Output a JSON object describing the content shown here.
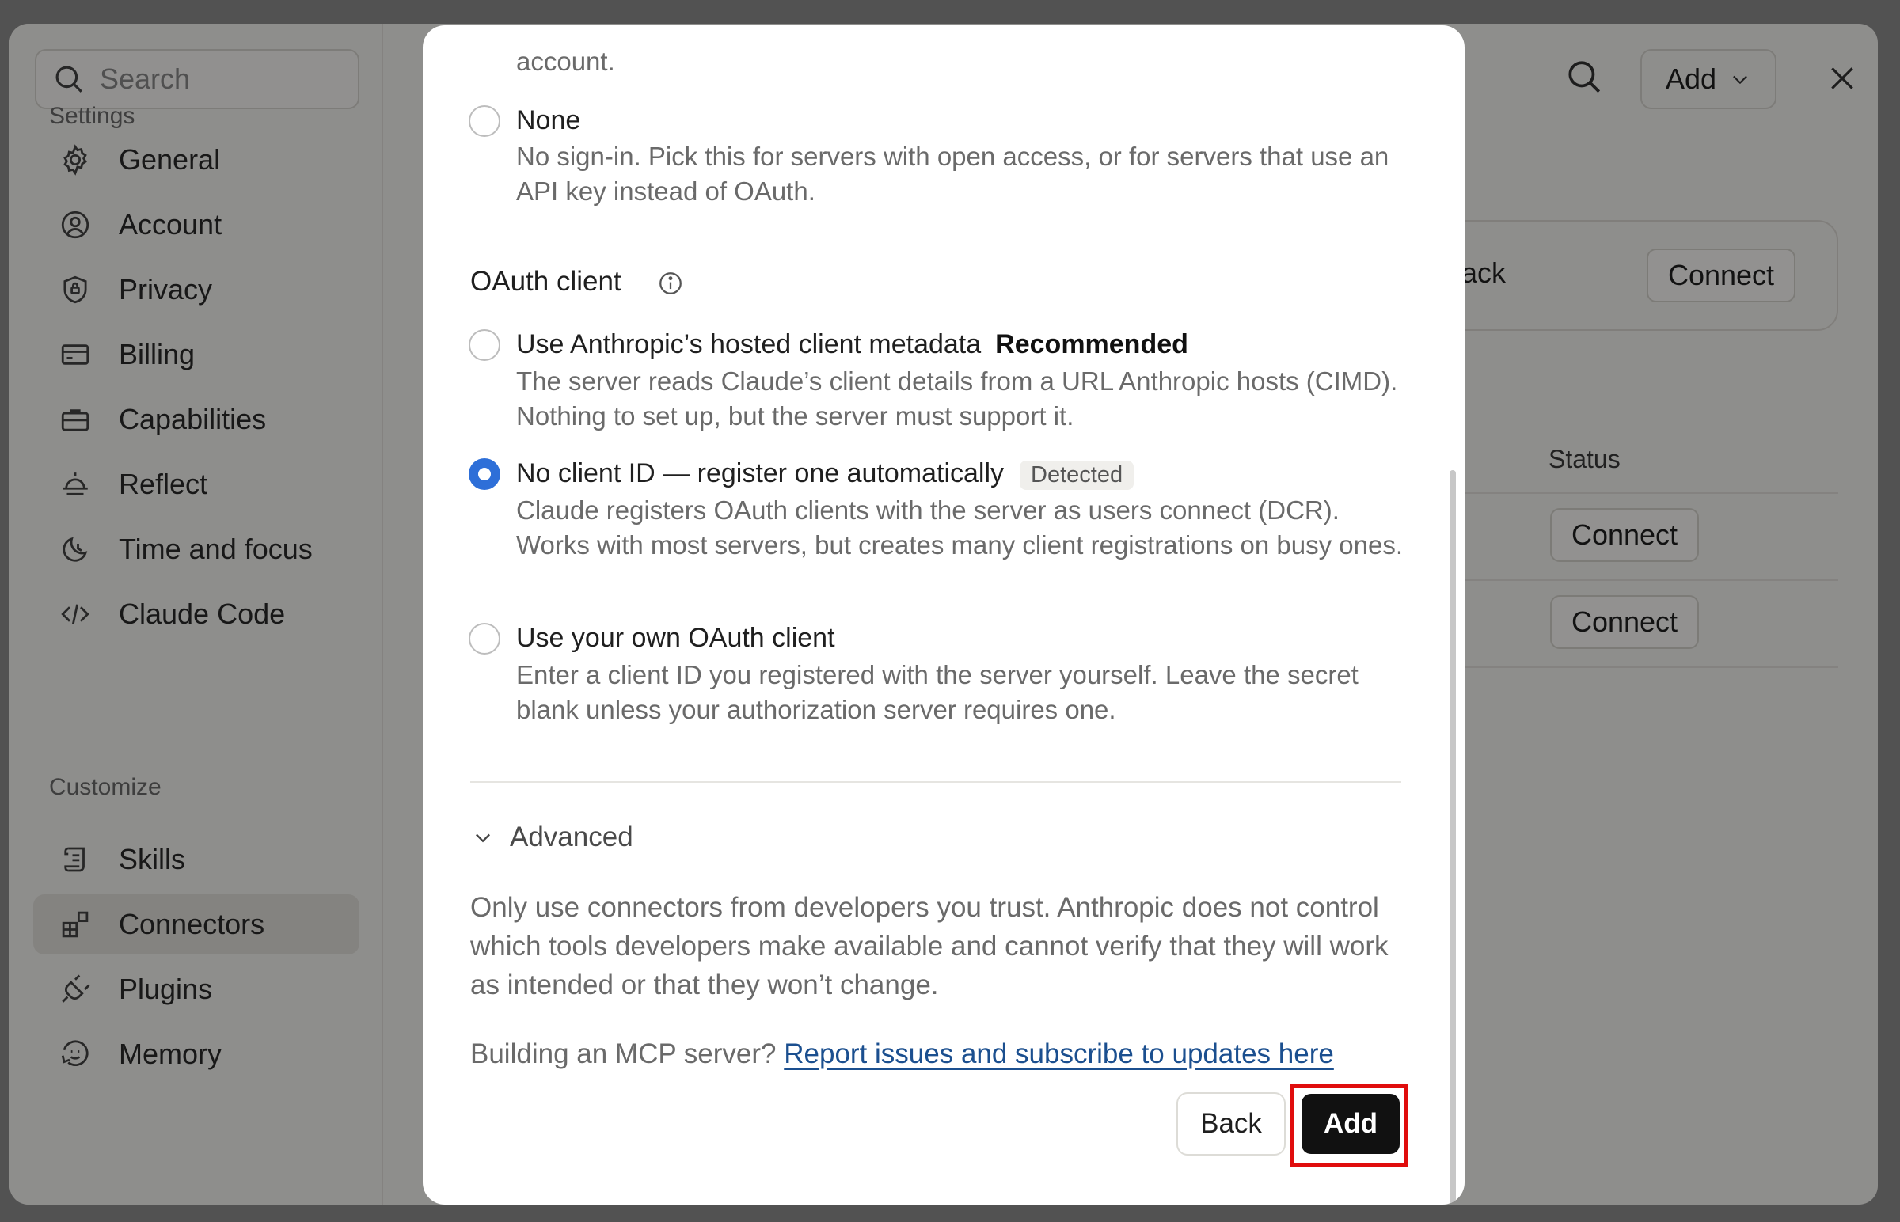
{
  "sidebar": {
    "search_placeholder": "Search",
    "settings_label": "Settings",
    "customize_label": "Customize",
    "settings_items": [
      {
        "label": "General",
        "icon": "gear-icon"
      },
      {
        "label": "Account",
        "icon": "user-circle-icon"
      },
      {
        "label": "Privacy",
        "icon": "shield-icon"
      },
      {
        "label": "Billing",
        "icon": "credit-card-icon"
      },
      {
        "label": "Capabilities",
        "icon": "briefcase-icon"
      },
      {
        "label": "Reflect",
        "icon": "sunrise-icon"
      },
      {
        "label": "Time and focus",
        "icon": "moon-clock-icon"
      },
      {
        "label": "Claude Code",
        "icon": "code-icon"
      }
    ],
    "customize_items": [
      {
        "label": "Skills",
        "icon": "scroll-icon"
      },
      {
        "label": "Connectors",
        "icon": "grid-plus-icon",
        "active": true
      },
      {
        "label": "Plugins",
        "icon": "plug-icon"
      },
      {
        "label": "Memory",
        "icon": "memory-icon"
      }
    ]
  },
  "main": {
    "add_label": "Add",
    "slack_name": "Slack",
    "connect_label": "Connect",
    "status_header": "Status"
  },
  "modal": {
    "clipped_top_text": "account.",
    "none_option": {
      "title": "None",
      "desc": "No sign-in. Pick this for servers with open access, or for servers that use an API key instead of OAuth."
    },
    "oauth_section_title": "OAuth client",
    "options": [
      {
        "title": "Use Anthropic’s hosted client metadata",
        "badge": "Recommended",
        "desc": "The server reads Claude’s client details from a URL Anthropic hosts (CIMD). Nothing to set up, but the server must support it.",
        "checked": false
      },
      {
        "title": "No client ID — register one automatically",
        "badge": "Detected",
        "desc": "Claude registers OAuth clients with the server as users connect (DCR). Works with most servers, but creates many client registrations on busy ones.",
        "checked": true
      },
      {
        "title": "Use your own OAuth client",
        "desc": "Enter a client ID you registered with the server yourself. Leave the secret blank unless your authorization server requires one.",
        "checked": false
      }
    ],
    "advanced_label": "Advanced",
    "warning": "Only use connectors from developers you trust. Anthropic does not control which tools developers make available and cannot verify that they will work as intended or that they won’t change.",
    "mcp_prefix": "Building an MCP server?",
    "mcp_link": "Report issues and subscribe to updates here",
    "back_label": "Back",
    "add_label": "Add"
  },
  "colors": {
    "accent_blue": "#2e6fd8",
    "link": "#1b4f8f",
    "highlight": "#e00d0d"
  }
}
